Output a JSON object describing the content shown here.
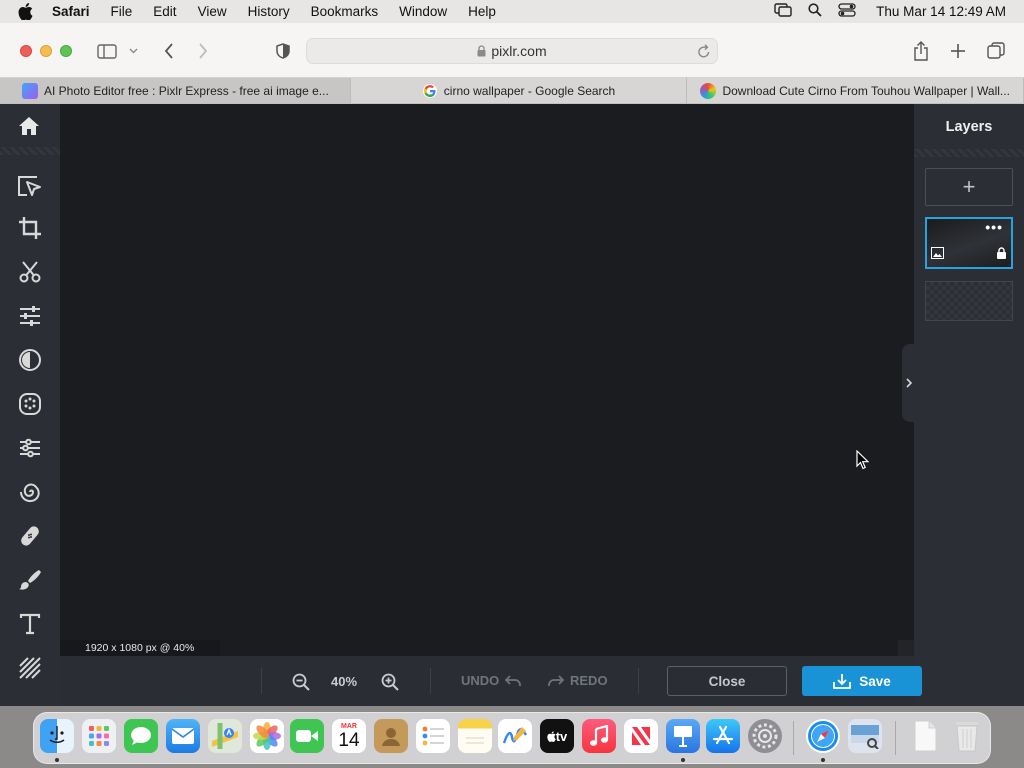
{
  "menubar": {
    "app_name": "Safari",
    "items": [
      "File",
      "Edit",
      "View",
      "History",
      "Bookmarks",
      "Window",
      "Help"
    ],
    "clock": "Thu Mar 14  12:49 AM"
  },
  "browser": {
    "url": "pixlr.com",
    "tabs": [
      {
        "title": "AI Photo Editor free : Pixlr Express - free ai image e..."
      },
      {
        "title": "cirno wallpaper - Google Search"
      },
      {
        "title": "Download Cute Cirno From Touhou Wallpaper | Wall..."
      }
    ]
  },
  "editor": {
    "layers_title": "Layers",
    "add_layer_symbol": "+",
    "layer_menu_symbol": "•••",
    "canvas_info": "1920 x 1080 px @ 40%",
    "zoom": "40%",
    "undo_label": "UNDO",
    "redo_label": "REDO",
    "close_label": "Close",
    "save_label": "Save",
    "accent_color": "#1a93d6"
  },
  "dock": {
    "calendar_month": "MAR",
    "calendar_day": "14",
    "tv_label": "tv"
  }
}
